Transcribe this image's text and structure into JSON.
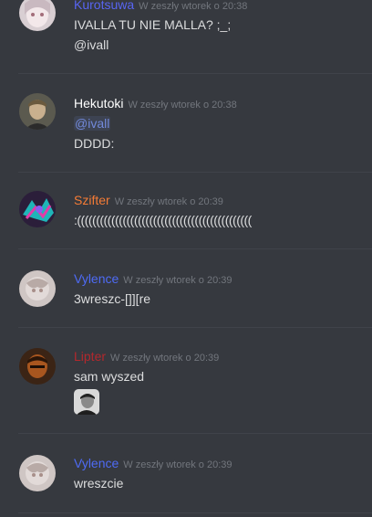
{
  "messages": [
    {
      "author": "Kurotsuwa",
      "author_color": "#5865f2",
      "timestamp": "W zeszły wtorek o 20:38",
      "lines": [
        "IVALLA TU NIE MALLA? ;_;",
        "@ivall"
      ]
    },
    {
      "author": "Hekutoki",
      "author_color": "#ffffff",
      "timestamp": "W zeszły wtorek o 20:38",
      "mention": "@ivall",
      "lines": [
        "DDDD:"
      ]
    },
    {
      "author": "Szifter",
      "author_color": "#f47b36",
      "timestamp": "W zeszły wtorek o 20:39",
      "lines": [
        ":(((((((((((((((((((((((((((((((((((((((((((((("
      ]
    },
    {
      "author": "Vylence",
      "author_color": "#4e6bf5",
      "timestamp": "W zeszły wtorek o 20:39",
      "lines": [
        "3wreszc-[]][re"
      ]
    },
    {
      "author": "Lipter",
      "author_color": "#b3282d",
      "timestamp": "W zeszły wtorek o 20:39",
      "lines": [
        "sam wyszed"
      ]
    },
    {
      "author": "Vylence",
      "author_color": "#4e6bf5",
      "timestamp": "W zeszły wtorek o 20:39",
      "lines": [
        "wreszcie"
      ]
    }
  ]
}
